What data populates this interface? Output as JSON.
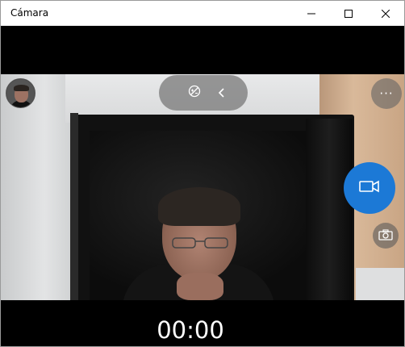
{
  "window": {
    "title": "Cámara",
    "controls": {
      "minimize_icon": "minimize-icon",
      "maximize_icon": "maximize-icon",
      "close_icon": "close-icon"
    }
  },
  "toolbar": {
    "exposure_icon": "exposure-off-icon",
    "collapse_icon": "chevron-left-icon",
    "more_label": "···"
  },
  "capture": {
    "video_icon": "video-camera-icon",
    "photo_icon": "camera-icon",
    "video_button_color": "#1c79d6"
  },
  "recording": {
    "timer": "00:00"
  },
  "gallery": {
    "thumbnail_icon": "last-capture-thumbnail"
  }
}
